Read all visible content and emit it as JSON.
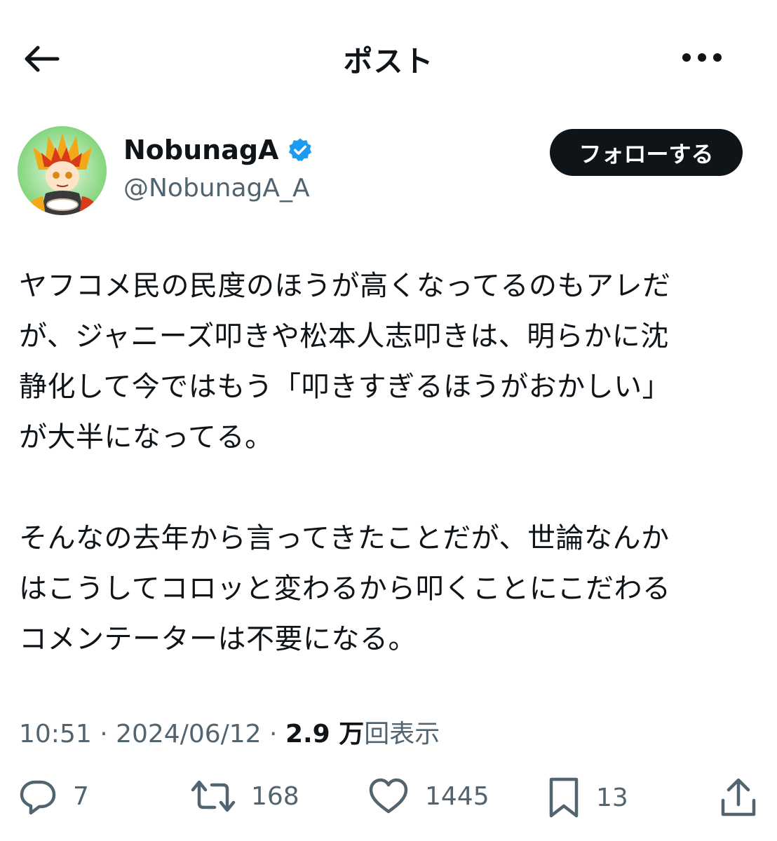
{
  "header": {
    "title": "ポスト",
    "back_icon": "arrow-left-icon",
    "more_icon": "ellipsis-icon"
  },
  "author": {
    "display_name": "NobunagA",
    "handle": "@NobunagA_A",
    "verified": true,
    "verified_color": "#1d9bf0",
    "follow_label": "フォローする"
  },
  "post": {
    "paragraphs": [
      "ヤフコメ民の民度のほうが高くなってるのもアレだ\nが、ジャニーズ叩きや松本人志叩きは、明らかに沈\n静化して今ではもう「叩きすぎるほうがおかしい」\nが大半になってる。",
      "そんなの去年から言ってきたことだが、世論なんか\nはこうしてコロッと変わるから叩くことにこだわる\nコメンテーターは不要になる。"
    ],
    "time": "10:51",
    "date": "2024/06/12",
    "separator": " · ",
    "views_count": "2.9 万",
    "views_label": "回表示"
  },
  "actions": {
    "replies": "7",
    "reposts": "168",
    "likes": "1445",
    "bookmarks": "13"
  },
  "colors": {
    "text": "#0f1419",
    "secondary": "#536471",
    "button_bg": "#0f1419"
  }
}
